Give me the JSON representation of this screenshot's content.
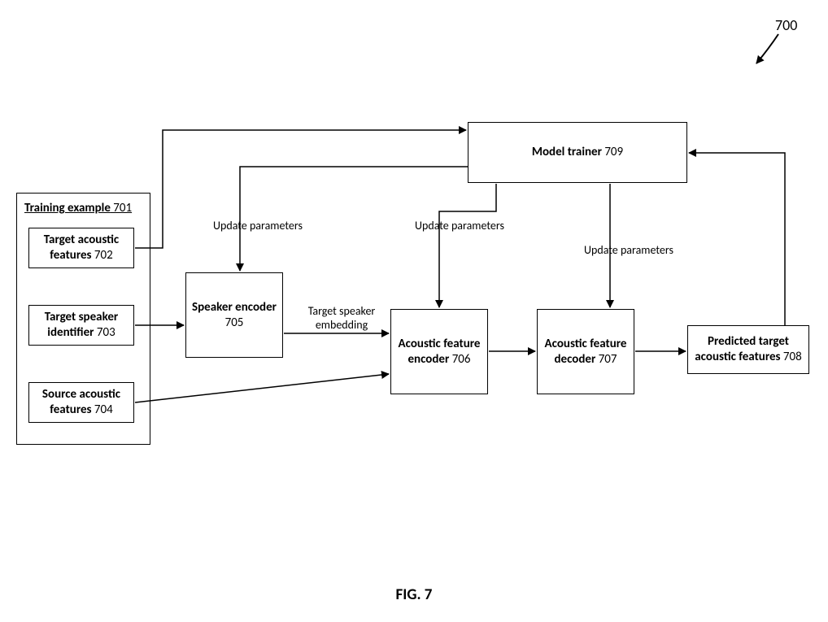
{
  "figure": {
    "number_label": "700",
    "caption": "FIG. 7"
  },
  "outer": {
    "title_bold": "Training example",
    "title_num": " 701"
  },
  "boxes": {
    "target_acoustic": {
      "bold": "Target acoustic features",
      "num": " 702"
    },
    "target_speaker": {
      "bold": "Target speaker identifier",
      "num": " 703"
    },
    "source_acoustic": {
      "bold": "Source acoustic features",
      "num": " 704"
    },
    "speaker_encoder": {
      "bold": "Speaker encoder",
      "num": " 705"
    },
    "afe": {
      "bold": "Acoustic feature encoder",
      "num": " 706"
    },
    "afd": {
      "bold": "Acoustic feature decoder",
      "num": " 707"
    },
    "predicted": {
      "bold": "Predicted target acoustic features",
      "num": " 708"
    },
    "model_trainer": {
      "bold": "Model trainer",
      "num": " 709"
    }
  },
  "edge_labels": {
    "up1": "Update parameters",
    "up2": "Update parameters",
    "up3": "Update parameters",
    "tse_line1": "Target speaker",
    "tse_line2": "embedding"
  }
}
